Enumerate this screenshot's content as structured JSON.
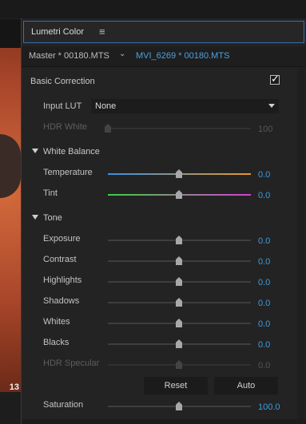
{
  "panel": {
    "title": "Lumetri Color"
  },
  "clip": {
    "master": "Master * 00180.MTS",
    "sequence": "MVI_6269 * 00180.MTS"
  },
  "preview": {
    "overlay_text": "13"
  },
  "basic": {
    "title": "Basic Correction",
    "enabled": true,
    "input_lut_label": "Input LUT",
    "input_lut_value": "None",
    "hdr_white_label": "HDR White",
    "hdr_white_value": "100"
  },
  "white_balance": {
    "title": "White Balance",
    "temperature": {
      "label": "Temperature",
      "value": "0.0",
      "colors": [
        "#3a8fe0",
        "#e8962a"
      ]
    },
    "tint": {
      "label": "Tint",
      "value": "0.0",
      "colors": [
        "#3fcf3f",
        "#d63fd6"
      ]
    }
  },
  "tone": {
    "title": "Tone",
    "sliders": [
      {
        "label": "Exposure",
        "value": "0.0"
      },
      {
        "label": "Contrast",
        "value": "0.0"
      },
      {
        "label": "Highlights",
        "value": "0.0"
      },
      {
        "label": "Shadows",
        "value": "0.0"
      },
      {
        "label": "Whites",
        "value": "0.0"
      },
      {
        "label": "Blacks",
        "value": "0.0"
      },
      {
        "label": "HDR Specular",
        "value": "0.0"
      }
    ]
  },
  "buttons": {
    "reset": "Reset",
    "auto": "Auto"
  },
  "saturation": {
    "label": "Saturation",
    "value": "100.0"
  },
  "colors": {
    "accent": "#3d9de0",
    "panel_bg": "#232323",
    "focus_border": "#3d6ea8"
  }
}
